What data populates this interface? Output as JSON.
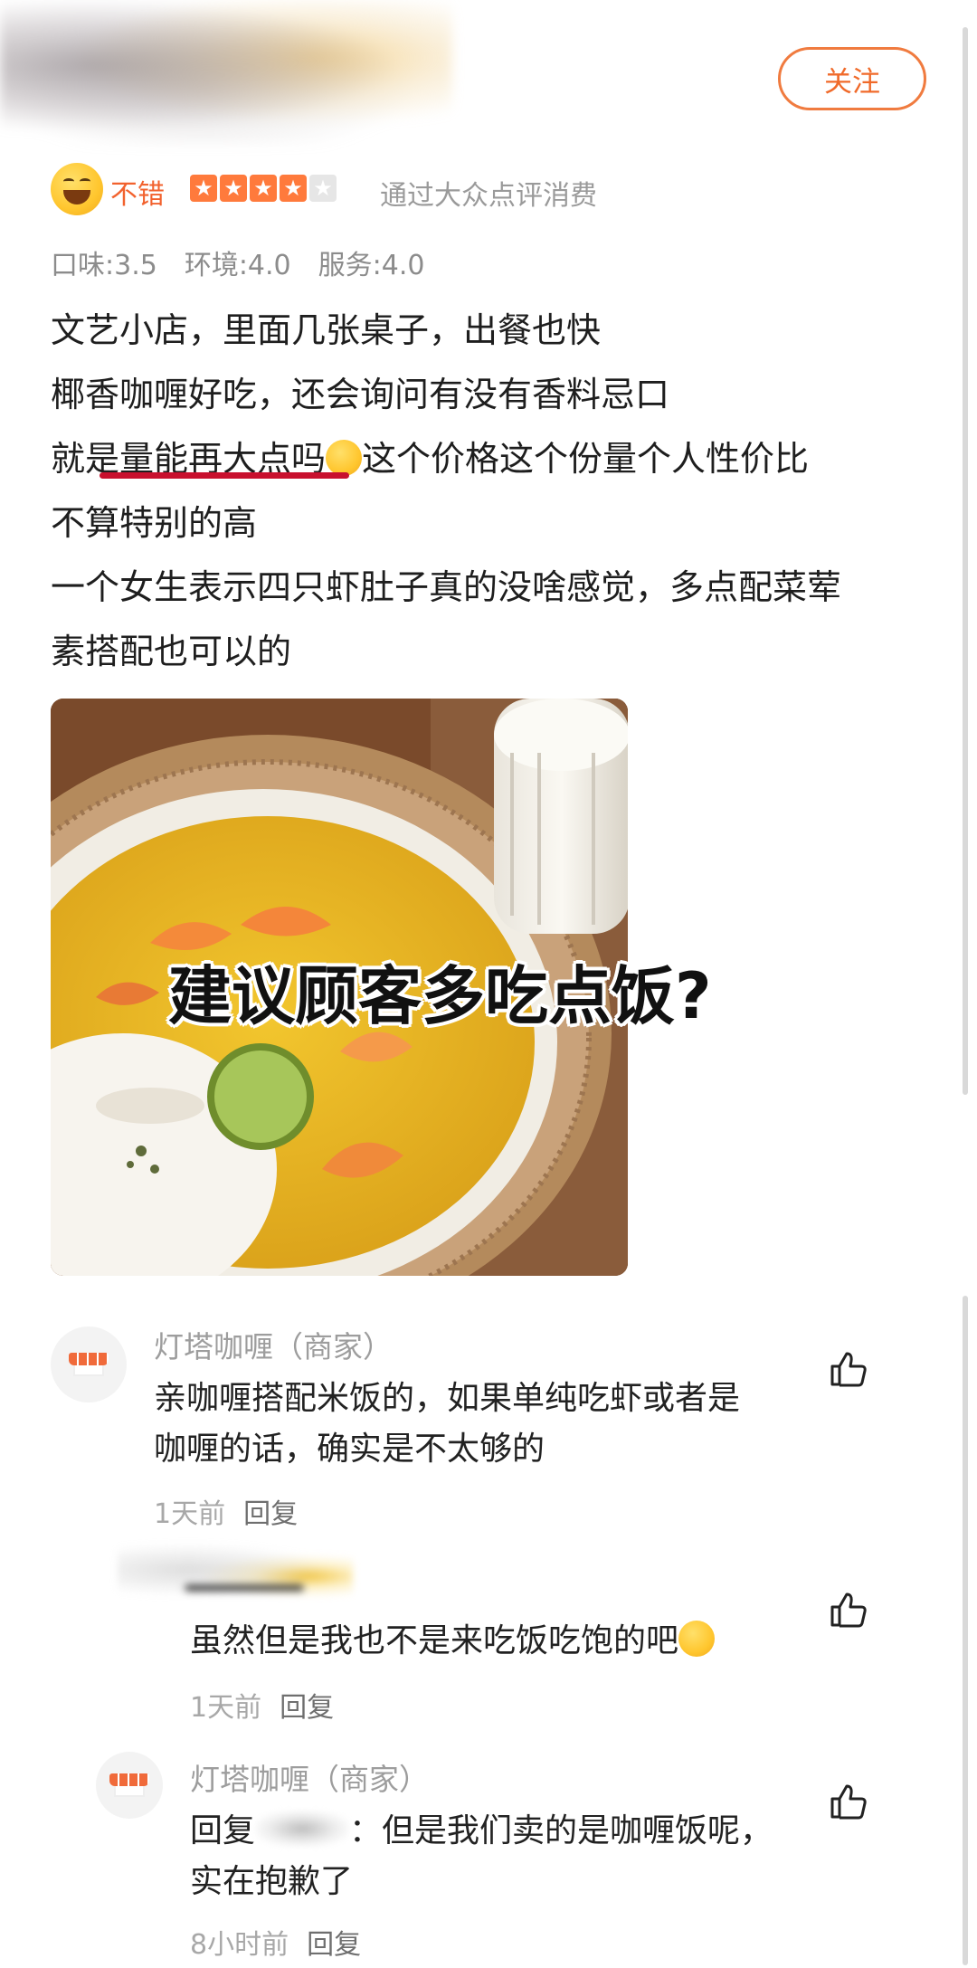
{
  "header": {
    "follow_label": "关注"
  },
  "rating": {
    "word": "不错",
    "stars_filled": 4,
    "stars_total": 5,
    "via": "通过大众点评消费",
    "scores": [
      "口味:3.5",
      "环境:4.0",
      "服务:4.0"
    ]
  },
  "review": {
    "line1": "文艺小店，里面几张桌子，出餐也快",
    "line2": "椰香咖喱好吃，还会询问有没有香料忌口",
    "line3_a": "就是",
    "line3_hl": "量能再大点吗",
    "line3_b": "这个价格这个份量个人性价比",
    "line4": "不算特别的高",
    "line5": "一个女生表示四只虾肚子真的没啥感觉，多点配菜荤",
    "line6": "素搭配也可以的"
  },
  "photo": {
    "overlay_text": "建议顾客多吃点饭?"
  },
  "comments": [
    {
      "author": "灯塔咖喱（商家）",
      "text_line1": "亲咖喱搭配米饭的，如果单纯吃虾或者是",
      "text_line2": "咖喱的话，确实是不太够的",
      "time": "1天前",
      "reply": "回复"
    },
    {
      "author": "",
      "text_line1": "虽然但是我也不是来吃饭吃饱的吧",
      "time": "1天前",
      "reply": "回复"
    },
    {
      "author": "灯塔咖喱（商家）",
      "text_prefix": "回复",
      "text_suffix": "：但是我们卖的是咖喱饭呢，",
      "text_line2": "实在抱歉了",
      "time": "8小时前",
      "reply": "回复"
    }
  ],
  "colors": {
    "accent": "#f06a2a",
    "star": "#ff7a3c",
    "underline": "#c8102e"
  },
  "icons": [
    "grinning-face-icon",
    "star-icon",
    "loudly-crying-face-icon",
    "shop-awning-icon",
    "thumbs-up-icon"
  ]
}
